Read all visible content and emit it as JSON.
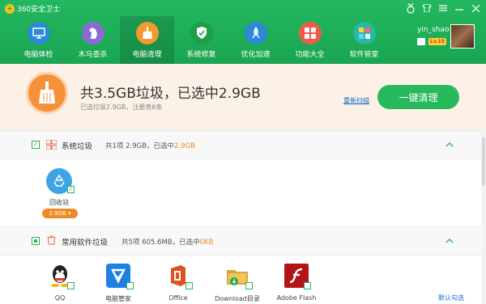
{
  "app": {
    "title": "360安全卫士"
  },
  "window_controls": [
    "medal-icon",
    "shirt-icon",
    "menu-icon",
    "minimize-icon",
    "close-icon"
  ],
  "tabs": [
    {
      "label": "电脑体检",
      "icon": "monitor-icon",
      "color": "#2a8ad8"
    },
    {
      "label": "木马查杀",
      "icon": "horse-icon",
      "color": "#8a6bd6"
    },
    {
      "label": "电脑清理",
      "icon": "broom-icon",
      "color": "#f39a2c",
      "active": true
    },
    {
      "label": "系统修复",
      "icon": "shield-icon",
      "color": "#1f9d4a"
    },
    {
      "label": "优化加速",
      "icon": "rocket-icon",
      "color": "#2a8ad8"
    },
    {
      "label": "功能大全",
      "icon": "grid-icon",
      "color": "#f05a4a"
    },
    {
      "label": "软件管家",
      "icon": "apps-icon",
      "color": "#26b8a8"
    }
  ],
  "user": {
    "name": "yin_shao",
    "level": "Lv.15"
  },
  "summary": {
    "title": "共3.5GB垃圾，已选中2.9GB",
    "subtitle": "已选垃圾2.9GB，注册表6条",
    "rescan_label": "重新扫描",
    "clean_button": "一键清理"
  },
  "sections": [
    {
      "title": "系统垃圾",
      "info_prefix": "共1项 2.9GB，已选中",
      "info_selected": "2.9GB",
      "items": [
        {
          "label": "回收站",
          "size": "2.9GB"
        }
      ]
    },
    {
      "title": "常用软件垃圾",
      "info_prefix": "共5项 605.6MB，已选中",
      "info_selected": "0KB",
      "items": [
        {
          "label": "QQ"
        },
        {
          "label": "电脑管家"
        },
        {
          "label": "Office"
        },
        {
          "label": "Download目录"
        },
        {
          "label": "Adobe Flash"
        }
      ],
      "default_select_label": "默认勾选"
    }
  ],
  "colors": {
    "header_green": "#1aa552",
    "accent_orange": "#f08a24",
    "button_green": "#28b95c"
  }
}
